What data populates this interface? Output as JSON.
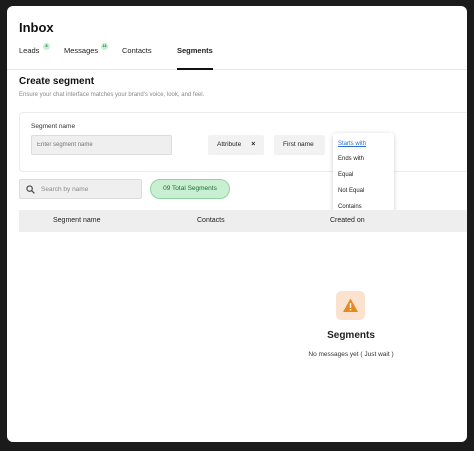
{
  "app": {
    "title": "Inbox"
  },
  "tabs": [
    {
      "label": "Leads",
      "badge": "8"
    },
    {
      "label": "Messages",
      "badge": "13"
    },
    {
      "label": "Contacts"
    },
    {
      "label": "Segments",
      "active": true
    }
  ],
  "create_segment": {
    "title": "Create segment",
    "subtitle": "Ensure your chat interface matches your brand's voice, look, and feel.",
    "name_label": "Segment name",
    "name_placeholder": "Enter segment name",
    "attribute_chip": "Attribute",
    "field_chip": "First name",
    "operator_options": [
      "Starts with",
      "Ends with",
      "Equal",
      "Not Equal",
      "Contains"
    ],
    "selected_operator": "Starts with"
  },
  "toolbar": {
    "search_placeholder": "Search by name",
    "total_label": "09 Total Segments"
  },
  "table": {
    "columns": [
      "Segment name",
      "Contacts",
      "Created on"
    ]
  },
  "empty_state": {
    "icon": "warning-icon",
    "title": "Segments",
    "message": "No messages yet ( Just wait )"
  },
  "colors": {
    "accent_green": "#c9efd2",
    "link_blue": "#2b6fd6",
    "warning_orange": "#e8891f"
  }
}
